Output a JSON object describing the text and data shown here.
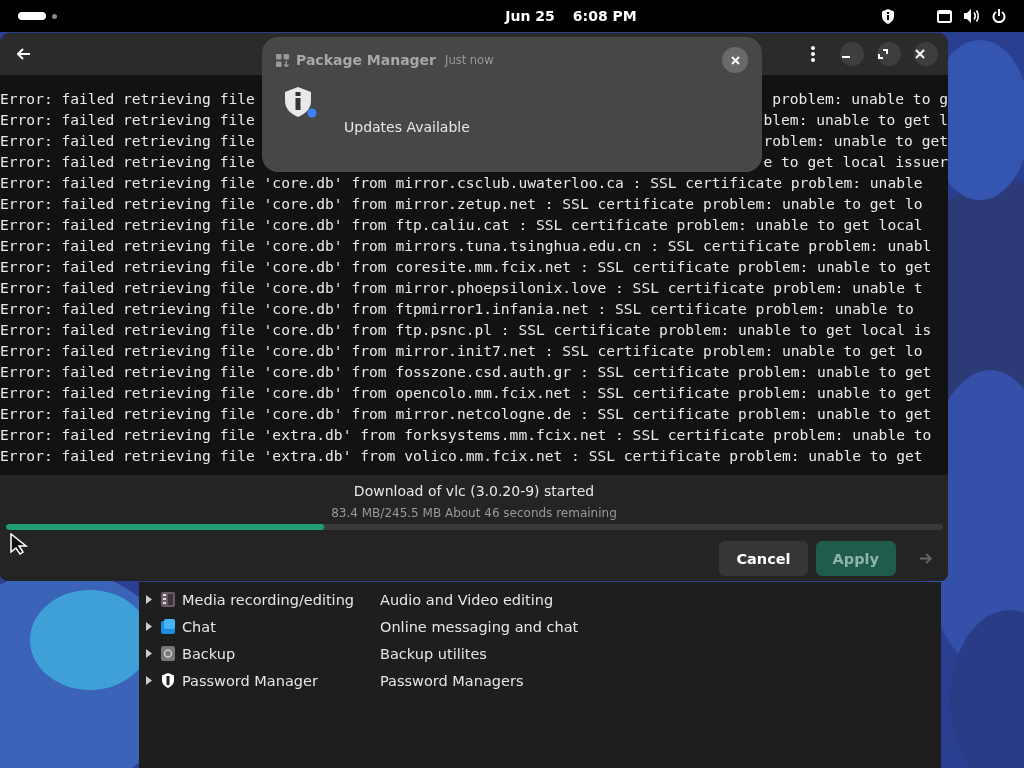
{
  "top_bar": {
    "date": "Jun 25",
    "time": "6:08 PM"
  },
  "dialog": {
    "log_lines": [
      {
        "kind": "covered",
        "left": "Error: failed retrieving file",
        "right": "problem: unable to g"
      },
      {
        "kind": "covered",
        "left": "Error: failed retrieving file",
        "right": "blem: unable to get l"
      },
      {
        "kind": "covered",
        "left": "Error: failed retrieving file",
        "right": "roblem: unable to get"
      },
      {
        "kind": "covered",
        "left": "Error: failed retrieving file",
        "right": "e to get local issuer"
      },
      {
        "kind": "full",
        "text": "Error: failed retrieving file 'core.db' from mirror.csclub.uwaterloo.ca : SSL certificate problem: unable"
      },
      {
        "kind": "full",
        "text": "Error: failed retrieving file 'core.db' from mirror.zetup.net : SSL certificate problem: unable to get lo"
      },
      {
        "kind": "full",
        "text": "Error: failed retrieving file 'core.db' from ftp.caliu.cat : SSL certificate problem: unable to get local"
      },
      {
        "kind": "full",
        "text": "Error: failed retrieving file 'core.db' from mirrors.tuna.tsinghua.edu.cn : SSL certificate problem: unabl"
      },
      {
        "kind": "full",
        "text": "Error: failed retrieving file 'core.db' from coresite.mm.fcix.net : SSL certificate problem: unable to get"
      },
      {
        "kind": "full",
        "text": "Error: failed retrieving file 'core.db' from mirror.phoepsilonix.love : SSL certificate problem: unable t"
      },
      {
        "kind": "full",
        "text": "Error: failed retrieving file 'core.db' from ftpmirror1.infania.net : SSL certificate problem: unable to"
      },
      {
        "kind": "full",
        "text": "Error: failed retrieving file 'core.db' from ftp.psnc.pl : SSL certificate problem: unable to get local is"
      },
      {
        "kind": "full",
        "text": "Error: failed retrieving file 'core.db' from mirror.init7.net : SSL certificate problem: unable to get lo"
      },
      {
        "kind": "full",
        "text": "Error: failed retrieving file 'core.db' from fosszone.csd.auth.gr : SSL certificate problem: unable to get"
      },
      {
        "kind": "full",
        "text": "Error: failed retrieving file 'core.db' from opencolo.mm.fcix.net : SSL certificate problem: unable to get"
      },
      {
        "kind": "full",
        "text": "Error: failed retrieving file 'core.db' from mirror.netcologne.de : SSL certificate problem: unable to get"
      },
      {
        "kind": "full",
        "text": "Error: failed retrieving file 'extra.db' from forksystems.mm.fcix.net : SSL certificate problem: unable to"
      },
      {
        "kind": "full",
        "text": "Error: failed retrieving file 'extra.db' from volico.mm.fcix.net : SSL certificate problem: unable to get"
      }
    ],
    "status": "Download of vlc (3.0.20-9) started",
    "progress_text": "83.4 MB/245.5 MB About 46 seconds remaining",
    "progress": {
      "level": 0.34
    },
    "buttons": [
      {
        "kind": "plain",
        "label": "Cancel",
        "disabled": false
      },
      {
        "kind": "suggested",
        "label": "Apply",
        "disabled": true
      },
      {
        "kind": "arrow",
        "disabled": true
      }
    ]
  },
  "notification": {
    "app": "Package Manager",
    "time": "Just now",
    "message": "Updates Available"
  },
  "categories": [
    {
      "name": "Media recording/editing",
      "description": "Audio and Video editing"
    },
    {
      "name": "Chat",
      "description": "Online messaging and chat"
    },
    {
      "name": "Backup",
      "description": "Backup utilites"
    },
    {
      "name": "Password Manager",
      "description": "Password Managers"
    }
  ]
}
